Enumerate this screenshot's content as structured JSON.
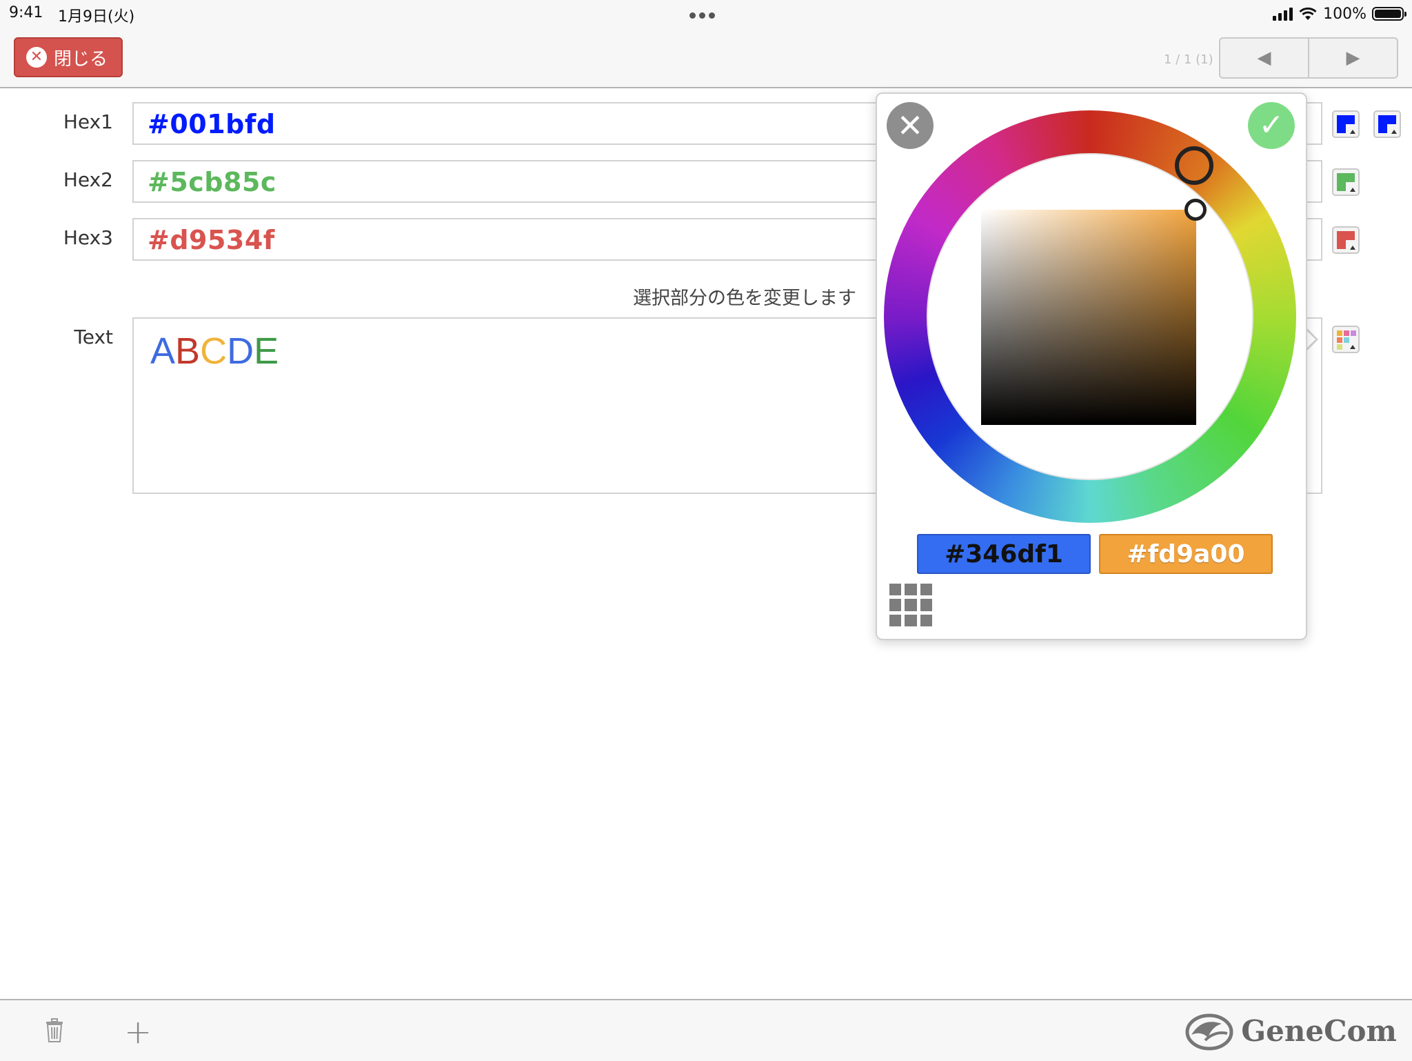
{
  "status_bar": {
    "time": "9:41",
    "date": "1月9日(火)",
    "battery": "100%"
  },
  "nav": {
    "close_label": "閉じる",
    "page_indicator": "1 / 1 (1)",
    "prev_glyph": "◀",
    "next_glyph": "▶"
  },
  "form": {
    "rows": [
      {
        "label": "Hex1",
        "value": "#001bfd",
        "color": "#001bfd"
      },
      {
        "label": "Hex2",
        "value": "#5cb85c",
        "color": "#5cb85c"
      },
      {
        "label": "Hex3",
        "value": "#d9534f",
        "color": "#d9534f"
      }
    ],
    "hint": "選択部分の色を変更します",
    "text_label": "Text",
    "text_letters": [
      {
        "ch": "A",
        "color": "#3d6be0"
      },
      {
        "ch": "B",
        "color": "#c0392b"
      },
      {
        "ch": "C",
        "color": "#f0b33a"
      },
      {
        "ch": "D",
        "color": "#3d6be0"
      },
      {
        "ch": "E",
        "color": "#3e9a47"
      }
    ]
  },
  "color_picker": {
    "close_glyph": "✕",
    "ok_glyph": "✓",
    "previous_color": "#346df1",
    "current_color": "#fd9a00",
    "palette_icon": "grid-icon"
  },
  "toolbar": {
    "trash_icon": "trash-icon",
    "add_glyph": "+",
    "brand_name": "GeneCom"
  }
}
